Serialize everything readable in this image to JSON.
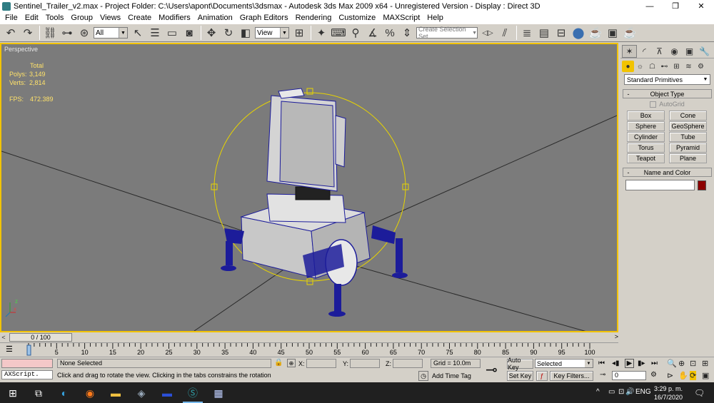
{
  "window": {
    "title": "Sentinel_Trailer_v2.max    - Project Folder: C:\\Users\\apont\\Documents\\3dsmax    - Autodesk 3ds Max  2009 x64    - Unregistered Version    - Display : Direct 3D",
    "minimize": "—",
    "restore": "❐",
    "close": "✕"
  },
  "menu": [
    "File",
    "Edit",
    "Tools",
    "Group",
    "Views",
    "Create",
    "Modifiers",
    "Animation",
    "Graph Editors",
    "Rendering",
    "Customize",
    "MAXScript",
    "Help"
  ],
  "toolbar": {
    "selection_filter": "All",
    "reference_coord": "View",
    "named_selection_placeholder": "Create Selection Set",
    "icons": {
      "undo": "↶",
      "redo": "↷",
      "link": "⛓",
      "unlink": "⊶",
      "bind": "⊛",
      "select": "↖",
      "select_by_name": "☰",
      "rect_region": "▭",
      "window_crossing": "◙",
      "move": "✥",
      "rotate": "↻",
      "scale": "◧",
      "pivot": "⊞",
      "manipulate": "✦",
      "keyboard": "⌨",
      "snap": "⚲",
      "angle_snap": "∡",
      "percent_snap": "%",
      "spinner_snap": "⇕",
      "mirror": "◁▷",
      "align": "⫽",
      "layers": "≣",
      "curve_editor": "▤",
      "schematic": "⊟",
      "material": "⬤",
      "render_setup": "☕",
      "render_frame": "▣",
      "quick_render": "☕"
    }
  },
  "viewport": {
    "label": "Perspective",
    "stats_header": "Total",
    "polys_label": "Polys:",
    "polys_value": "3,149",
    "verts_label": "Verts:",
    "verts_value": "2,814",
    "fps_label": "FPS:",
    "fps_value": "472.389",
    "axis_z": "z",
    "axis_x": "x"
  },
  "command_panel": {
    "tabs": [
      "✶",
      "◜",
      "⊼",
      "◉",
      "▣",
      "🔧"
    ],
    "categories": [
      "●",
      "☼",
      "☖",
      "⊷",
      "⊞",
      "≋",
      "⚙"
    ],
    "category_dropdown": "Standard Primitives",
    "object_type_title": "Object Type",
    "autogrid_label": "AutoGrid",
    "object_buttons": [
      "Box",
      "Cone",
      "Sphere",
      "GeoSphere",
      "Cylinder",
      "Tube",
      "Torus",
      "Pyramid",
      "Teapot",
      "Plane"
    ],
    "name_color_title": "Name and Color",
    "minus": "-",
    "swatch_color": "#8c0000"
  },
  "time_slider": {
    "position": "0 / 100",
    "prev": "<",
    "next": ">"
  },
  "track_bar": {
    "ticks": [
      "5",
      "10",
      "15",
      "20",
      "25",
      "30",
      "35",
      "40",
      "45",
      "50",
      "55",
      "60",
      "65",
      "70",
      "75",
      "80",
      "85",
      "90",
      "95",
      "100"
    ]
  },
  "status": {
    "script_listener": "AXScript.",
    "selection": "None Selected",
    "prompt": "Click and drag to rotate the view.  Clicking in the tabs constrains the rotation",
    "lock_icon": "🔒",
    "abs_icon": "⊕",
    "x_label": "X:",
    "y_label": "Y:",
    "z_label": "Z:",
    "grid": "Grid = 10.0m",
    "add_time_tag": "Add Time Tag",
    "auto_key": "Auto Key",
    "set_key": "Set Key",
    "selected_dropdown": "Selected",
    "key_filters": "Key Filters...",
    "frame": "0",
    "key_icon": "⊸",
    "time_tag_icon": "◷",
    "playback": [
      "⏮",
      "◂▮",
      "▶",
      "▮▸",
      "⏭"
    ],
    "key_mode": "⊸",
    "time_config": "⚙",
    "nav_icons": [
      "🔍",
      "⊕",
      "⊡",
      "⊞",
      "⊳",
      "✋",
      "⟳",
      "▣"
    ]
  },
  "taskbar": {
    "start": "⊞",
    "task_view": "⧉",
    "time": "3:29 p. m.",
    "date": "16/7/2020",
    "language": "ENG",
    "tray_up": "^",
    "tray_icons": [
      "▭",
      "⊡",
      "🔊"
    ],
    "notifications": "🗨",
    "app_icons": [
      "◐",
      "◉",
      "▬",
      "◈",
      "▬",
      "Ⓢ",
      "▦"
    ]
  }
}
